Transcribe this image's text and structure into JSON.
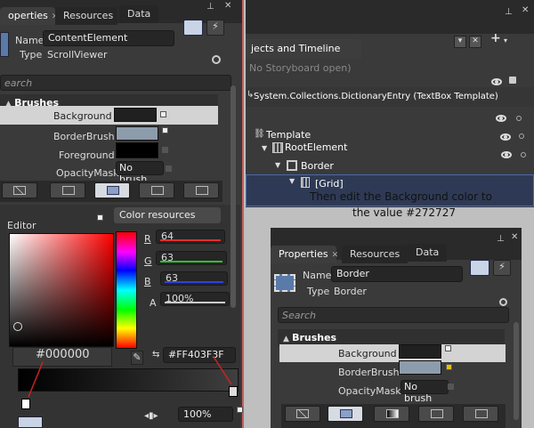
{
  "left_panel": {
    "tabs": [
      {
        "label": "operties"
      },
      {
        "label": "Resources"
      },
      {
        "label": "Data"
      }
    ],
    "name_label": "Name",
    "name_value": "ContentElement",
    "type_label": "Type",
    "type_value": "ScrollViewer",
    "search_placeholder": "earch",
    "section": "Brushes",
    "brushes": [
      {
        "label": "Background",
        "value": "",
        "color": "#202020"
      },
      {
        "label": "BorderBrush",
        "value": "",
        "color": "#8d9cab"
      },
      {
        "label": "Foreground",
        "value": "",
        "color": "#000000"
      },
      {
        "label": "OpacityMask",
        "value": "No brush",
        "color": ""
      }
    ],
    "editor_label": "Editor",
    "color_resources_label": "Color resources",
    "r_label": "R",
    "r_value": "64",
    "g_label": "G",
    "g_value": "63",
    "b_label": "B",
    "b_value": "63",
    "a_label": "A",
    "a_value": "100%",
    "hex_value": "#FF403F3F",
    "annotation_hex": "#000000",
    "stop_opacity": "100%"
  },
  "objects_panel": {
    "title": "jects and Timeline",
    "storyboard": "No Storyboard open)",
    "template_entry": "System.Collections.DictionaryEntry (TextBox Template)",
    "tree": [
      {
        "label": "Template",
        "indent": 0
      },
      {
        "label": "RootElement",
        "indent": 1
      },
      {
        "label": "Border",
        "indent": 2
      },
      {
        "label": "[Grid]",
        "indent": 3
      }
    ]
  },
  "caption": {
    "line1": "Then edit the Background color to",
    "line2": "the value #272727"
  },
  "right_panel": {
    "tabs": [
      {
        "label": "Properties"
      },
      {
        "label": "Resources"
      },
      {
        "label": "Data"
      }
    ],
    "name_label": "Name",
    "name_value": "Border",
    "type_label": "Type",
    "type_value": "Border",
    "search_placeholder": "Search",
    "section": "Brushes",
    "brushes": [
      {
        "label": "Background",
        "value": "",
        "color": "#202020"
      },
      {
        "label": "BorderBrush",
        "value": "",
        "color": "#8d9cab"
      },
      {
        "label": "OpacityMask",
        "value": "No brush",
        "color": ""
      }
    ]
  },
  "colors": {
    "accent_red": "#cc2222",
    "selection": "#2e3a55"
  }
}
